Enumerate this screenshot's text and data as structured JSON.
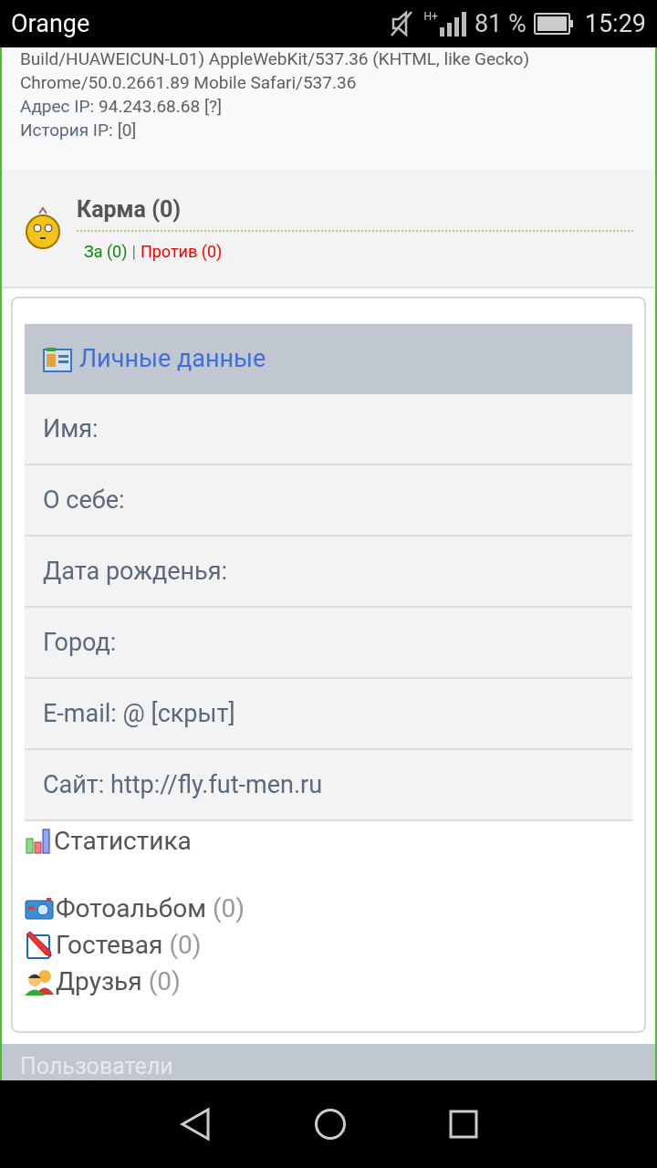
{
  "status_bar": {
    "carrier": "Orange",
    "network": "H+",
    "battery": "81 %",
    "time": "15:29"
  },
  "info": {
    "lines": [
      {
        "kind": "plain",
        "text": "Build/HUAWEICUN-L01) AppleWebKit/537.36 (KHTML, like Gecko)"
      },
      {
        "kind": "plain",
        "text": "Chrome/50.0.2661.89 Mobile Safari/537.36"
      },
      {
        "kind": "label",
        "label": "Адрес IP:",
        "value": "94.243.68.68 [?]"
      },
      {
        "kind": "label",
        "label": "История IP:",
        "value": "[0]"
      }
    ]
  },
  "karma": {
    "title": "Карма (0)",
    "for": "За (0)",
    "separator": "|",
    "against": "Против (0)"
  },
  "personal": {
    "title": "Личные данные",
    "rows": [
      "Имя:",
      "О себе:",
      "Дата рожденья:",
      "Город:",
      "E-mail: @ [скрыт]",
      "Сайт: http://fly.fut-men.ru"
    ]
  },
  "links": [
    {
      "kind": "stats",
      "label": "Статистика"
    },
    {
      "kind": "photo",
      "label": "Фотоальбом",
      "count": "(0)"
    },
    {
      "kind": "guest",
      "label": "Гостевая",
      "count": "(0)"
    },
    {
      "kind": "friends",
      "label": "Друзья",
      "count": "(0)"
    }
  ],
  "next_section": {
    "title": "Пользователи"
  }
}
